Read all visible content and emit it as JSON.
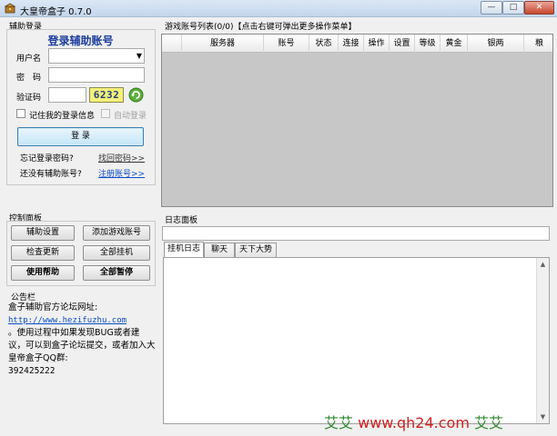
{
  "window": {
    "title": "大皇帝盒子 0.7.0",
    "min_glyph": "—",
    "max_glyph": "□",
    "close_glyph": "✕"
  },
  "login": {
    "group_label": "辅助登录",
    "title": "登录辅助账号",
    "username_label": "用户名",
    "username_value": "",
    "password_label": "密　码",
    "password_value": "",
    "captcha_label": "验证码",
    "captcha_value": "",
    "captcha_image_text": "6232",
    "remember_label": "记住我的登录信息",
    "autologin_label": "自动登录",
    "login_button": "登 录",
    "forgot_text": "忘记登录密码?",
    "forgot_link": "找回密码>>",
    "register_text": "还没有辅助账号?",
    "register_link": "注册账号>>"
  },
  "control_panel": {
    "label": "控制面板",
    "buttons": [
      "辅助设置",
      "添加游戏账号",
      "检查更新",
      "全部挂机",
      "使用帮助",
      "全部暂停"
    ]
  },
  "notice": {
    "label": "公告栏",
    "line1": "盒子辅助官方论坛网址:",
    "url": "http://www.hezifuzhu.com",
    "line2": "。使用过程中如果发现BUG或者建议，可以到盒子论坛提交，或者加入大皇帝盒子QQ群:",
    "qq": "392425222"
  },
  "account_list": {
    "label": "游戏账号列表(0/0)【点击右键可弹出更多操作菜单】",
    "columns": [
      "",
      "服务器",
      "账号",
      "状态",
      "连接",
      "操作",
      "设置",
      "等级",
      "黄金",
      "银两",
      "粮"
    ]
  },
  "log_panel": {
    "label": "日志面板",
    "tabs": [
      "挂机日志",
      "聊天",
      "天下大势"
    ]
  },
  "watermark": {
    "prefix": "艾艾",
    "url": "www.qh24.com",
    "suffix": "艾艾"
  },
  "colors": {
    "title_blue": "#1a3c9c",
    "link_blue": "#0b4ec8",
    "captcha_bg": "#f4f07a",
    "list_bg": "#c7c7c7",
    "watermark_green": "#2f8a2f",
    "watermark_red": "#d02020"
  },
  "icons": {
    "app": "treasure-box-icon",
    "refresh": "refresh-icon"
  }
}
